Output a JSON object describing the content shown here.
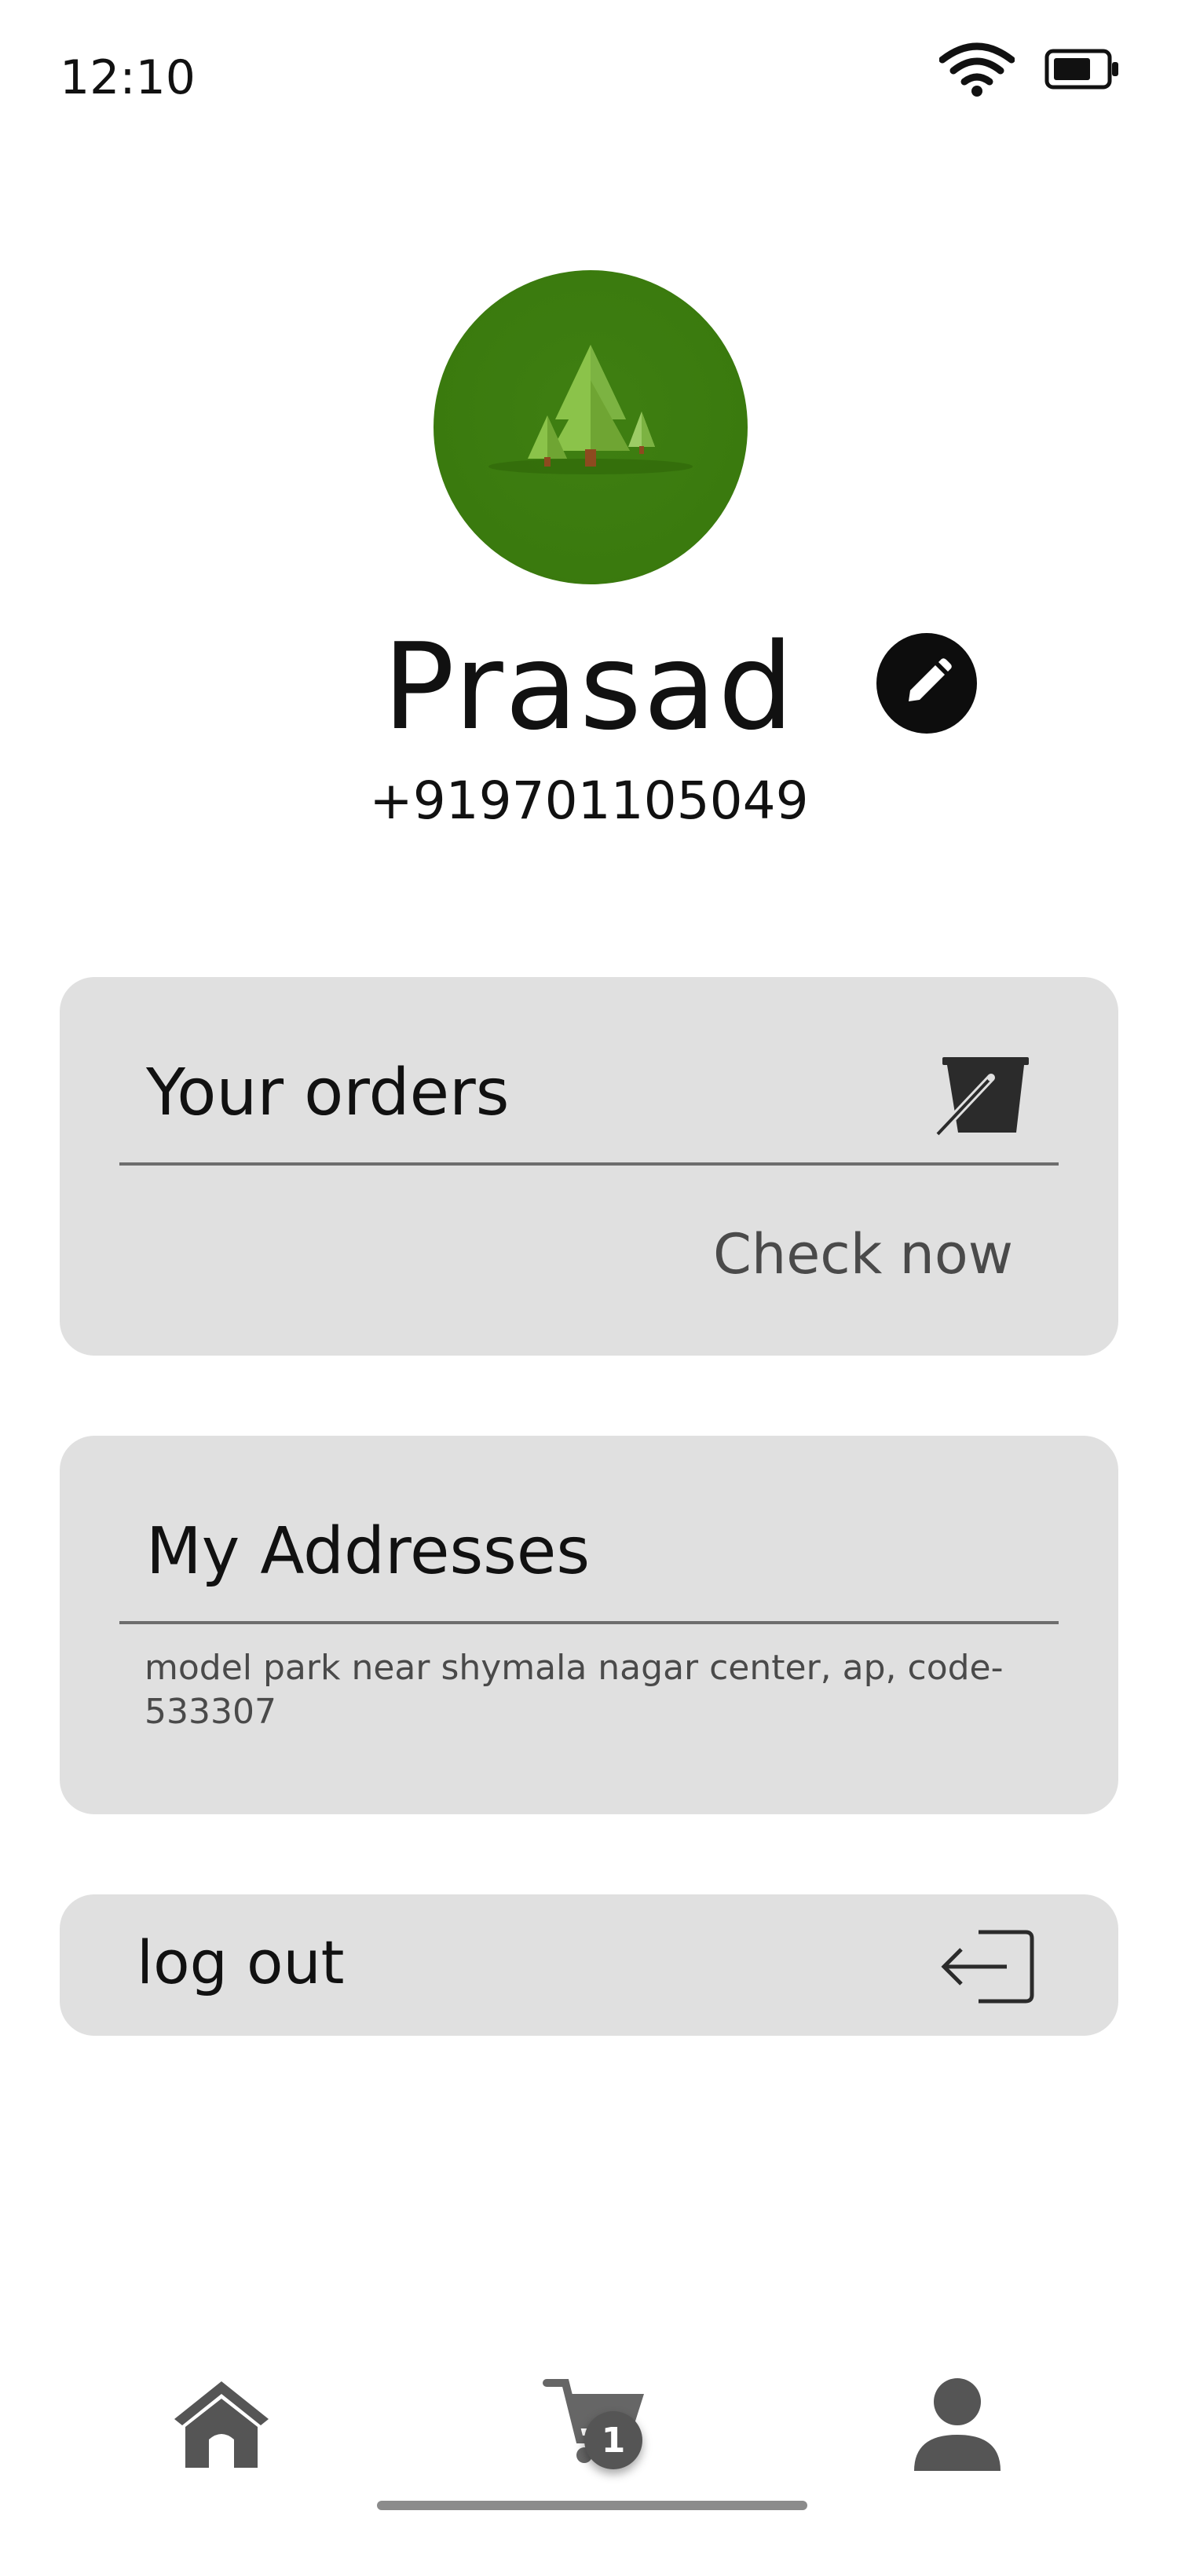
{
  "status_bar": {
    "time": "12:10",
    "icons": [
      "wifi-icon",
      "battery-icon"
    ]
  },
  "profile": {
    "avatar_icon": "forest-trees-avatar",
    "name": "Prasad",
    "phone": "+919701105049",
    "edit_icon": "pencil-icon"
  },
  "orders_card": {
    "title": "Your orders",
    "icon": "bucket-icon",
    "action_label": "Check now"
  },
  "addresses_card": {
    "title": "My Addresses",
    "address": "model park near shymala nagar center, ap, code- 533307"
  },
  "logout_card": {
    "label": "log out",
    "icon": "logout-icon"
  },
  "bottom_nav": {
    "items": [
      {
        "name": "home",
        "icon": "home-icon"
      },
      {
        "name": "cart",
        "icon": "cart-icon",
        "badge": "1"
      },
      {
        "name": "profile",
        "icon": "person-icon"
      }
    ]
  },
  "colors": {
    "avatar_bg": "#3a7a0e",
    "card_bg": "#e0e0e0",
    "icon_dark": "#2b2b2b",
    "muted_text": "#4a4a4a"
  }
}
